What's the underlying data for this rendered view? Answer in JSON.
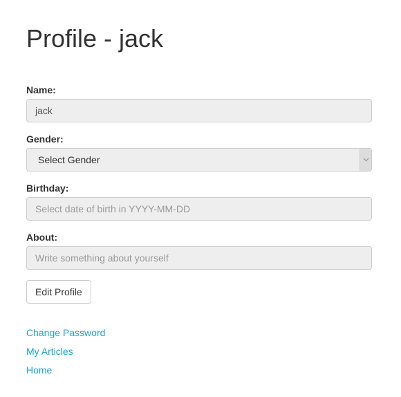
{
  "page": {
    "title": "Profile - jack"
  },
  "form": {
    "name": {
      "label": "Name:",
      "value": "jack"
    },
    "gender": {
      "label": "Gender:",
      "selected": "Select Gender"
    },
    "birthday": {
      "label": "Birthday:",
      "placeholder": "Select date of birth in YYYY-MM-DD"
    },
    "about": {
      "label": "About:",
      "placeholder": "Write something about yourself"
    },
    "edit_button": "Edit Profile"
  },
  "links": {
    "change_password": "Change Password",
    "my_articles": "My Articles",
    "home": "Home"
  },
  "colors": {
    "link": "#1aa3d9",
    "field_background": "#eeeeee",
    "text": "#333333"
  },
  "icons": {
    "select_arrow": "chevron-down-icon"
  }
}
